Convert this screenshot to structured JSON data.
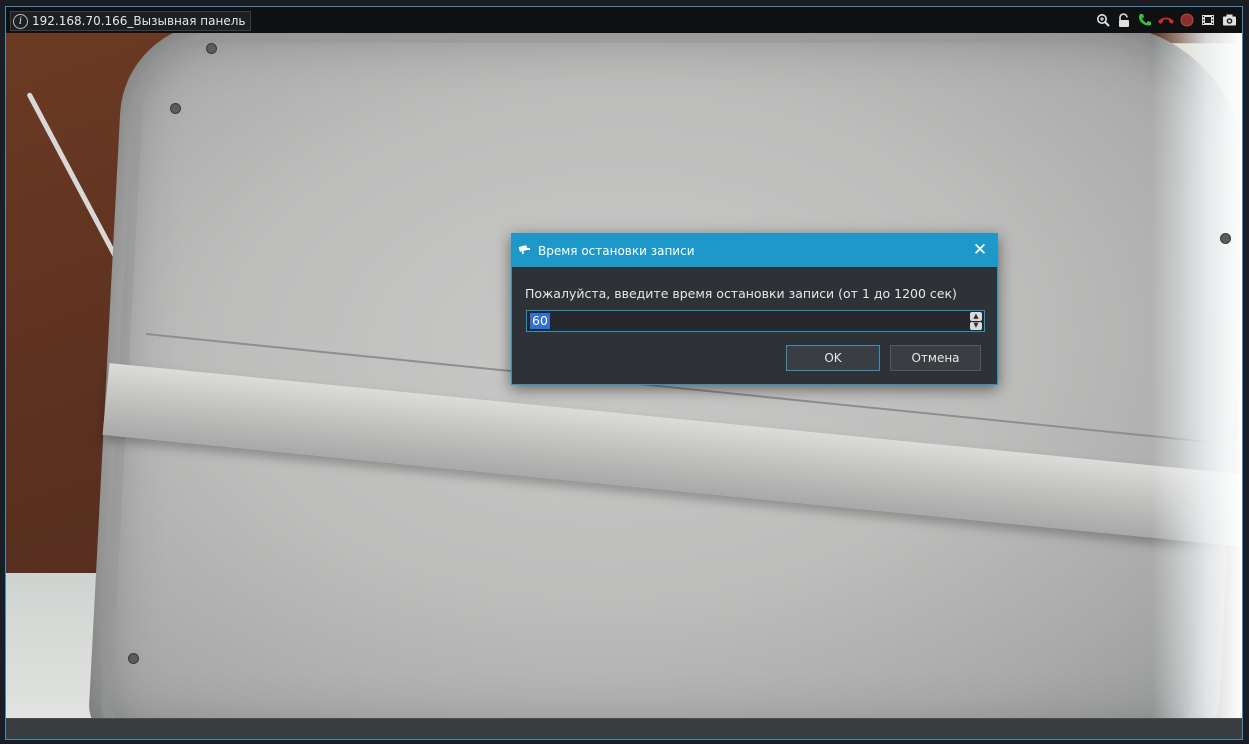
{
  "camera": {
    "title": "192.168.70.166_Вызывная панель",
    "info_icon": "info-icon",
    "toolbar_icons": [
      "zoom-icon",
      "lock-icon",
      "phone-accept-icon",
      "phone-hangup-icon",
      "record-icon",
      "film-icon",
      "camera-snapshot-icon"
    ]
  },
  "dialog": {
    "title": "Время остановки записи",
    "prompt": "Пожалуйста, введите время остановки записи (от 1 до 1200 сек)",
    "value": "60",
    "ok_label": "OK",
    "cancel_label": "Отмена",
    "close_icon": "close-icon"
  },
  "colors": {
    "accent": "#1e98c8",
    "dialog_bg": "#2e3136",
    "selection": "#2f6fd6"
  }
}
